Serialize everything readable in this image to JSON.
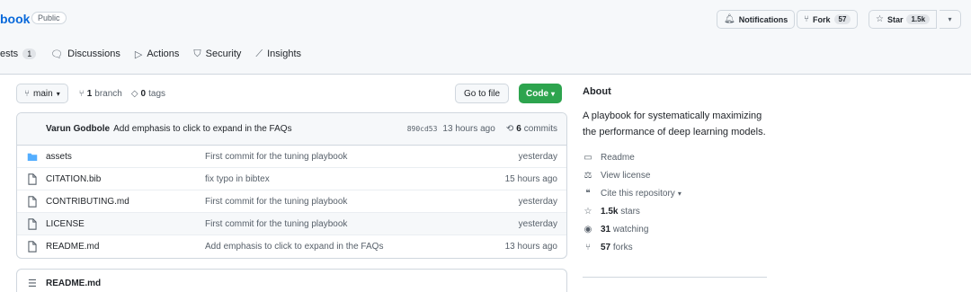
{
  "repo": {
    "name": "book",
    "visibility": "Public"
  },
  "header": {
    "notifications": "Notifications",
    "fork": {
      "label": "Fork",
      "count": "57"
    },
    "star": {
      "label": "Star",
      "count": "1.5k"
    }
  },
  "tabs": [
    {
      "label": "ests",
      "count": "1"
    },
    {
      "label": "Discussions"
    },
    {
      "label": "Actions"
    },
    {
      "label": "Security"
    },
    {
      "label": "Insights"
    }
  ],
  "branch": {
    "current": "main",
    "branches_count": "1",
    "branches_label": "branch",
    "tags_count": "0",
    "tags_label": "tags"
  },
  "buttons": {
    "go_to_file": "Go to file",
    "code": "Code"
  },
  "commit": {
    "author": "Varun Godbole",
    "message": "Add emphasis to click to expand in the FAQs",
    "sha": "890cd53",
    "time": "13 hours ago",
    "commits_count": "6",
    "commits_label": "commits"
  },
  "files": [
    {
      "name": "assets",
      "type": "folder",
      "message": "First commit for the tuning playbook",
      "time": "yesterday"
    },
    {
      "name": "CITATION.bib",
      "type": "file",
      "message": "fix typo in bibtex",
      "time": "15 hours ago"
    },
    {
      "name": "CONTRIBUTING.md",
      "type": "file",
      "message": "First commit for the tuning playbook",
      "time": "yesterday"
    },
    {
      "name": "LICENSE",
      "type": "file",
      "message": "First commit for the tuning playbook",
      "time": "yesterday"
    },
    {
      "name": "README.md",
      "type": "file",
      "message": "Add emphasis to click to expand in the FAQs",
      "time": "13 hours ago"
    }
  ],
  "readme": {
    "label": "README.md"
  },
  "about": {
    "title": "About",
    "description": "A playbook for systematically maximizing the performance of deep learning models.",
    "readme": "Readme",
    "license": "View license",
    "cite": "Cite this repository",
    "stars_count": "1.5k",
    "stars_label": "stars",
    "watching_count": "31",
    "watching_label": "watching",
    "forks_count": "57",
    "forks_label": "forks"
  },
  "colors": {
    "accent": "#0969da",
    "code_button": "#2da44e",
    "folder": "#54aeff"
  }
}
